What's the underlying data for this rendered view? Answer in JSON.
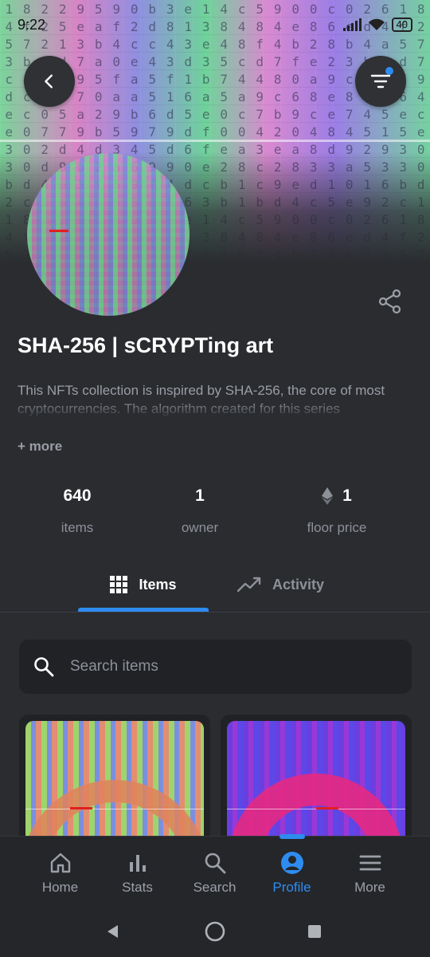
{
  "status_bar": {
    "time": "9:22",
    "battery": "40"
  },
  "banner": {
    "hex_rows": [
      "18229590b3e14c5900c026",
      "4f25eaf2d8138484e86ed",
      "57213b4cc43e48f4b28b4a",
      "3b1d7a0e43d35cd7fe2",
      "c4ef95fa5f1b74480a9",
      "dc6470aa516a5a9c68e8",
      "ec05a29b6d5e0c7b9ce745",
      "e0779b5979df00420484515",
      "302d4d345d6fea3ea8d929",
      "30d9b2a6990e28c2833a53",
      "bd4e3f59f4dcb1c9ed1016",
      "2c1a4b60e863b1bd4c5e9"
    ]
  },
  "collection": {
    "title": "SHA-256 | sCRYPTing art",
    "description": "This NFTs collection is inspired by SHA-256, the core of most cryptocurrencies. The algorithm created for this series",
    "more_label": "+ more"
  },
  "stats": [
    {
      "value": "640",
      "label": "items"
    },
    {
      "value": "1",
      "label": "owner"
    },
    {
      "value": "1",
      "label": "floor price",
      "icon": "ethereum-icon"
    }
  ],
  "tabs": [
    {
      "label": "Items",
      "icon": "grid-icon",
      "active": true
    },
    {
      "label": "Activity",
      "icon": "trending-icon",
      "active": false
    }
  ],
  "search": {
    "placeholder": "Search items",
    "value": ""
  },
  "bottom_nav": [
    {
      "label": "Home",
      "icon": "home-icon"
    },
    {
      "label": "Stats",
      "icon": "bar-chart-icon"
    },
    {
      "label": "Search",
      "icon": "search-icon"
    },
    {
      "label": "Profile",
      "icon": "profile-icon",
      "active": true
    },
    {
      "label": "More",
      "icon": "menu-icon"
    }
  ],
  "colors": {
    "accent": "#2e8cf0",
    "background": "#2a2c30",
    "surface": "#202226"
  }
}
